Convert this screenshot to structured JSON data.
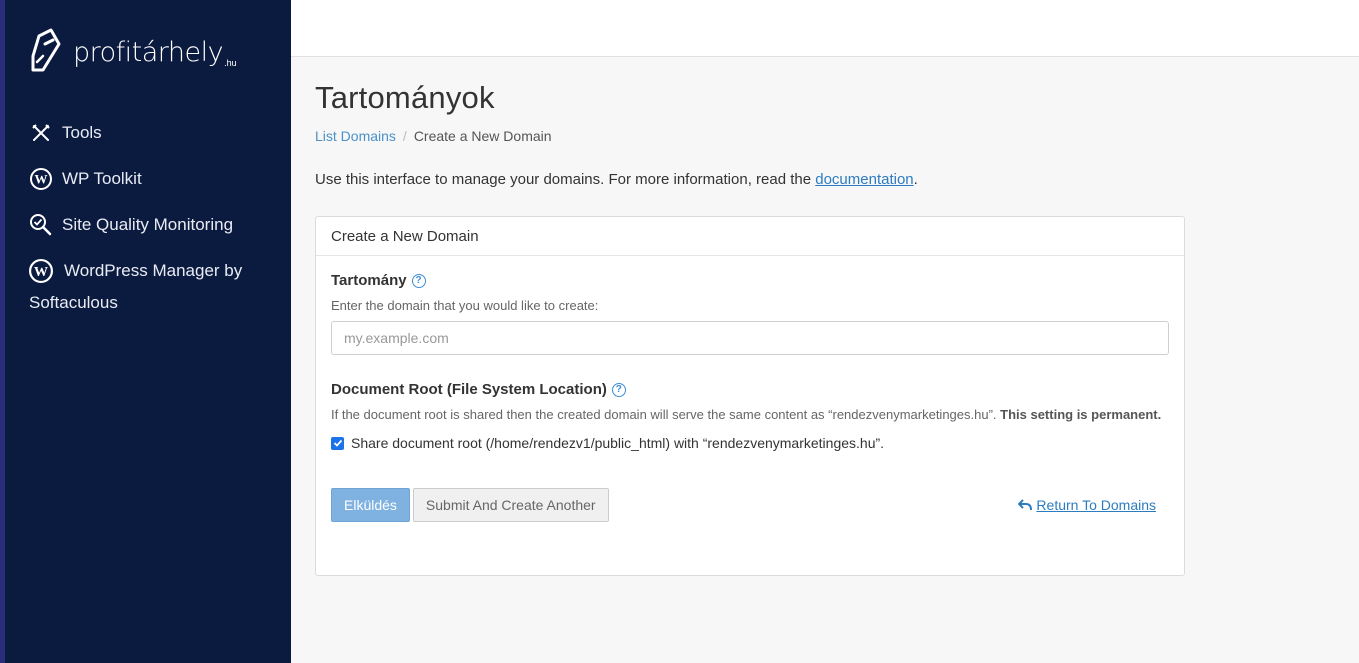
{
  "brand": {
    "name": "profitárhely",
    "tld": ".hu"
  },
  "sidebar": {
    "items": [
      {
        "label": "Tools",
        "icon": "tools-icon"
      },
      {
        "label": "WP Toolkit",
        "icon": "wordpress-icon"
      },
      {
        "label": "Site Quality Monitoring",
        "icon": "search-check-icon"
      },
      {
        "label_line1": "WordPress Manager by",
        "label_line2": "Softaculous",
        "icon": "wordpress-icon"
      }
    ]
  },
  "page": {
    "title": "Tartományok",
    "breadcrumb": {
      "link": "List Domains",
      "current": "Create a New Domain"
    },
    "intro_text": "Use this interface to manage your domains. For more information, read the ",
    "intro_link": "documentation",
    "intro_end": "."
  },
  "form": {
    "panel_title": "Create a New Domain",
    "domain_label": "Tartomány",
    "domain_hint": "Enter the domain that you would like to create:",
    "domain_placeholder": "my.example.com",
    "docroot_label": "Document Root (File System Location)",
    "docroot_hint": "If the document root is shared then the created domain will serve the same content as “rendezvenymarketinges.hu”. ",
    "docroot_hint_bold": "This setting is permanent.",
    "share_checkbox_label": "Share document root (/home/rendezv1/public_html) with “rendezvenymarketinges.hu”.",
    "share_checked": true,
    "submit_label": "Elküldés",
    "submit_another_label": "Submit And Create Another",
    "return_label": "Return To Domains"
  },
  "colors": {
    "sidebar_bg": "#0b1a3f",
    "accent": "#2e7cc0",
    "primary_button": "#7fb2e0"
  }
}
